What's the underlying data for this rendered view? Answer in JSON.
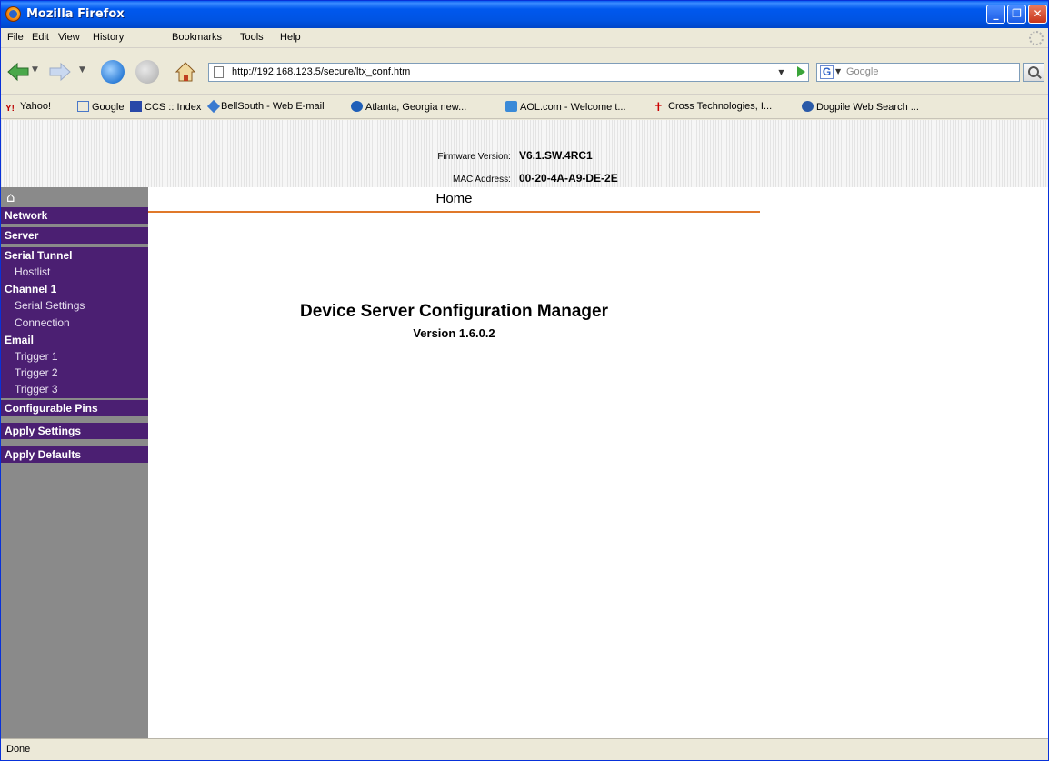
{
  "window": {
    "title": "Mozilla Firefox"
  },
  "menu": [
    "File",
    "Edit",
    "View",
    "History",
    "Bookmarks",
    "Tools",
    "Help"
  ],
  "navigation": {
    "url": "http://192.168.123.5/secure/ltx_conf.htm",
    "search_placeholder": "Google"
  },
  "bookmarks": [
    "Yahoo!",
    "Google",
    "CCS :: Index",
    "BellSouth - Web E-mail",
    "Atlanta, Georgia new...",
    "AOL.com - Welcome t...",
    "Cross Technologies, I...",
    "Dogpile Web Search ..."
  ],
  "device_info": {
    "firmware_label": "Firmware Version:",
    "firmware_value": "V6.1.SW.4RC1",
    "mac_label": "MAC Address:",
    "mac_value": "00-20-4A-A9-DE-2E"
  },
  "sidebar": {
    "network": "Network",
    "server": "Server",
    "serial_tunnel": "Serial Tunnel",
    "hostlist": "Hostlist",
    "channel1": "Channel 1",
    "serial_settings": "Serial Settings",
    "connection": "Connection",
    "email": "Email",
    "trigger1": "Trigger 1",
    "trigger2": "Trigger 2",
    "trigger3": "Trigger 3",
    "configurable_pins": "Configurable Pins",
    "apply_settings": "Apply Settings",
    "apply_defaults": "Apply Defaults"
  },
  "main": {
    "section_title": "Home",
    "app_title": "Device Server Configuration Manager",
    "app_version": "Version 1.6.0.2"
  },
  "status": "Done",
  "colors": {
    "sidebar_purple": "#4b1f72",
    "sidebar_gray": "#8a8a8a",
    "accent_orange": "#e0792a"
  }
}
